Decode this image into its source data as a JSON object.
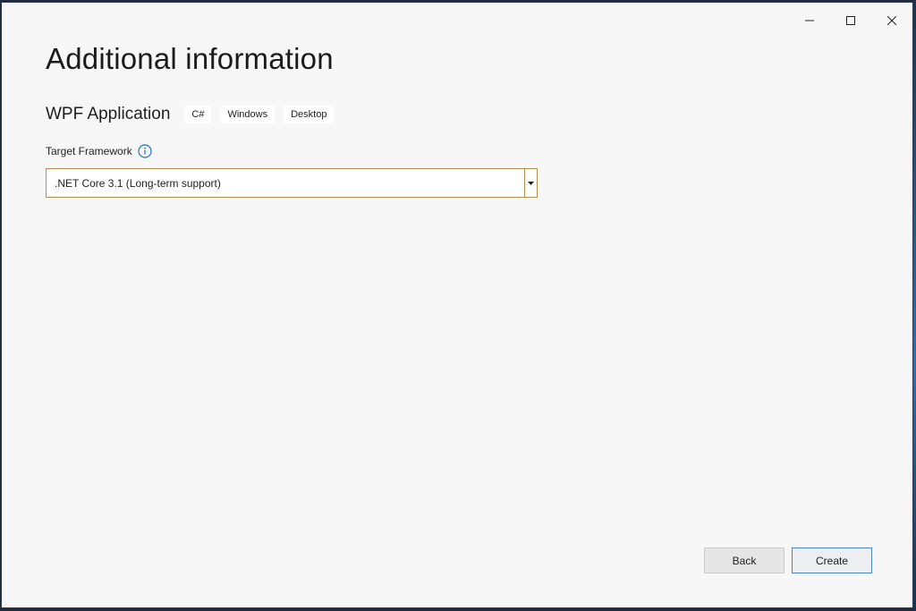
{
  "window": {
    "title": "Additional information",
    "controls": {
      "minimize": "minimize-icon",
      "maximize": "maximize-icon",
      "close": "close-icon"
    }
  },
  "project": {
    "name": "WPF Application",
    "tags": [
      "C#",
      "Windows",
      "Desktop"
    ]
  },
  "framework": {
    "label": "Target Framework",
    "info_icon": "info-icon",
    "selected": ".NET Core 3.1 (Long-term support)"
  },
  "footer": {
    "back_label": "Back",
    "create_label": "Create"
  },
  "colors": {
    "accent_border": "#b28f4a",
    "primary_border": "#4a86c9",
    "info_blue": "#1c73c9"
  }
}
